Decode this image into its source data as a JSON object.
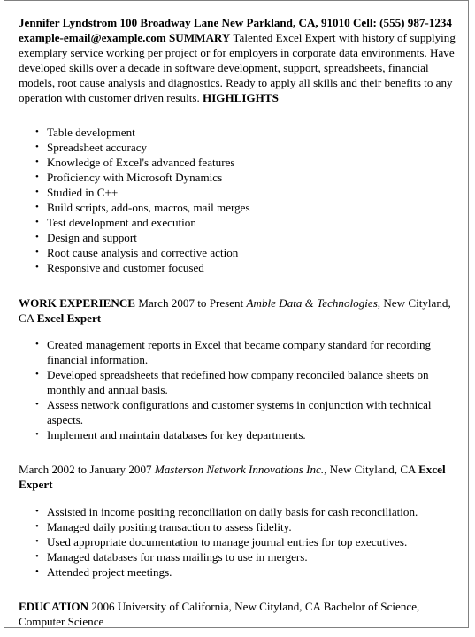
{
  "document": {
    "type": "resume",
    "page_border_color": "#808080",
    "background_color": "#ffffff",
    "text_color": "#000000",
    "header": {
      "name": "Jennifer Lyndstrom",
      "address": "100 Broadway Lane New Parkland, CA, 91010",
      "phone_label": "Cell:",
      "phone": "(555) 987-1234",
      "email": "example-email@example.com"
    },
    "summary": {
      "heading": "SUMMARY",
      "body": "Talented Excel Expert with history of supplying exemplary service working per project or for employers in corporate data environments. Have developed skills over a decade in software development, support, spreadsheets, financial models, root cause analysis and diagnostics. Ready to apply all skills and their benefits to any operation with customer driven results."
    },
    "highlights": {
      "heading": "HIGHLIGHTS",
      "items": [
        "Table development",
        "Spreadsheet accuracy",
        "Knowledge of Excel's advanced features",
        "Proficiency with Microsoft Dynamics",
        "Studied in C++",
        "Build scripts, add-ons, macros, mail merges",
        "Test development and execution",
        "Design and support",
        "Root cause analysis and corrective action",
        "Responsive and customer focused"
      ]
    },
    "work_experience": {
      "heading": "WORK EXPERIENCE",
      "jobs": [
        {
          "dates": "March 2007 to Present",
          "company": "Amble Data & Technologies",
          "location": ", New Cityland, CA",
          "title": "Excel Expert",
          "bullets": [
            "Created management reports in Excel that became company standard for recording financial information.",
            "Developed spreadsheets that redefined how company reconciled balance sheets on monthly and annual basis.",
            "Assess network configurations and customer systems in conjunction with technical aspects.",
            "Implement and maintain databases for key departments."
          ]
        },
        {
          "dates": "March 2002 to January 2007",
          "company": "Masterson Network Innovations Inc.",
          "location": ", New Cityland, CA",
          "title": "Excel Expert",
          "bullets": [
            "Assisted in income positing reconciliation on daily basis for cash reconciliation.",
            "Managed daily positing transaction to assess fidelity.",
            "Used appropriate documentation to manage journal entries for top executives.",
            "Managed databases for mass mailings to use in mergers.",
            "Attended project meetings."
          ]
        }
      ]
    },
    "education": {
      "heading": "EDUCATION",
      "year": "2006",
      "school": "University of California, New Cityland, CA",
      "degree": "Bachelor of Science, Computer Science"
    }
  }
}
